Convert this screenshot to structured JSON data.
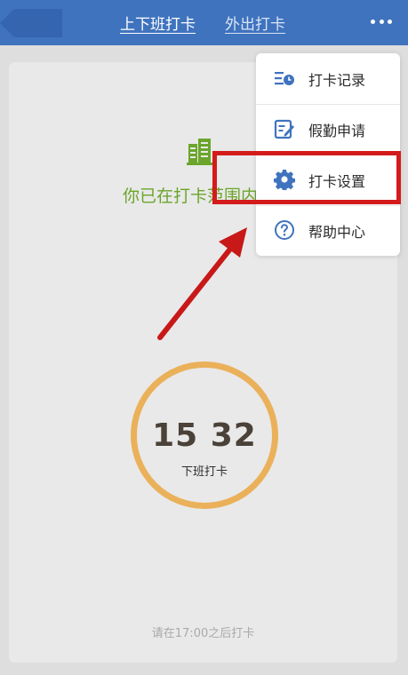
{
  "header": {
    "tab_active": "上下班打卡",
    "tab_inactive": "外出打卡"
  },
  "main": {
    "range_text": "你已在打卡范围内",
    "clock_time": "15 32",
    "clock_label": "下班打卡",
    "hint": "请在17:00之后打卡"
  },
  "menu": {
    "items": [
      {
        "label": "打卡记录",
        "icon": "clock-list-icon"
      },
      {
        "label": "假勤申请",
        "icon": "edit-form-icon"
      },
      {
        "label": "打卡设置",
        "icon": "gear-icon"
      },
      {
        "label": "帮助中心",
        "icon": "help-icon"
      }
    ]
  },
  "colors": {
    "header": "#3f73be",
    "accent_green": "#6ba52b",
    "ring": "#eab15a",
    "highlight": "#d41b1b",
    "menu_icon": "#3f73be"
  }
}
